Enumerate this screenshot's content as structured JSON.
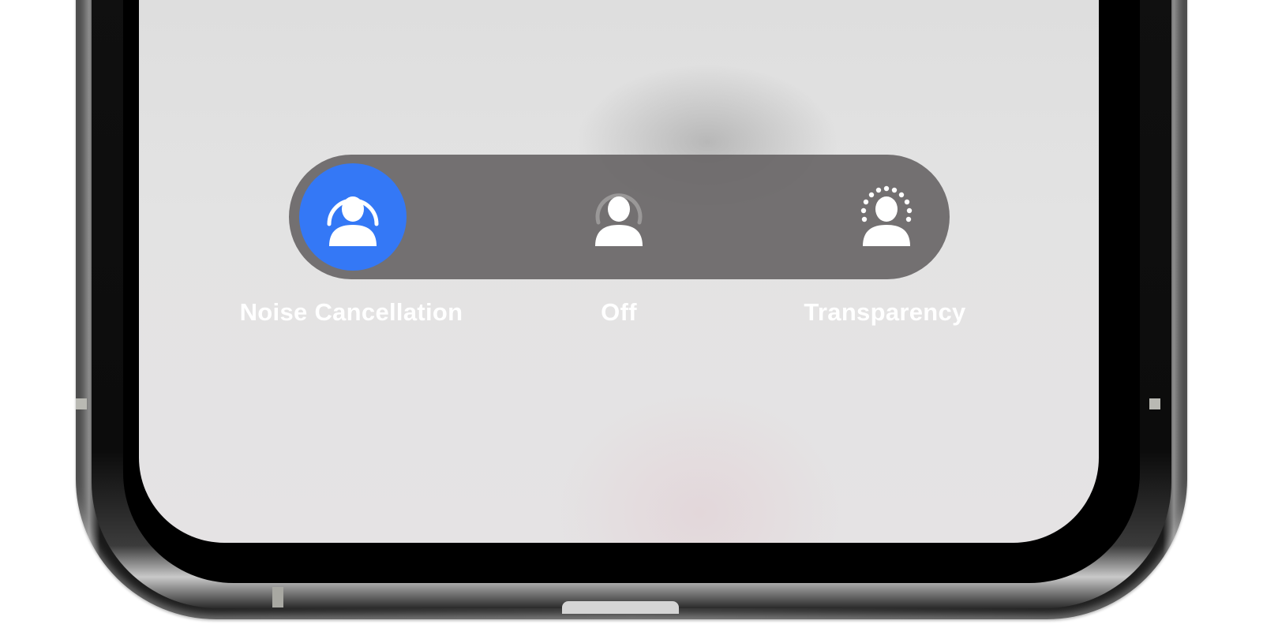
{
  "noise_control": {
    "selected": "noise-cancellation",
    "active_color": "#3478f6",
    "pill_color": "#6b6869",
    "options": [
      {
        "id": "noise-cancellation",
        "label": "Noise Cancellation",
        "icon": "noise-cancellation-icon",
        "active": true
      },
      {
        "id": "off",
        "label": "Off",
        "icon": "person-off-icon",
        "active": false
      },
      {
        "id": "transparency",
        "label": "Transparency",
        "icon": "transparency-icon",
        "active": false
      }
    ]
  }
}
